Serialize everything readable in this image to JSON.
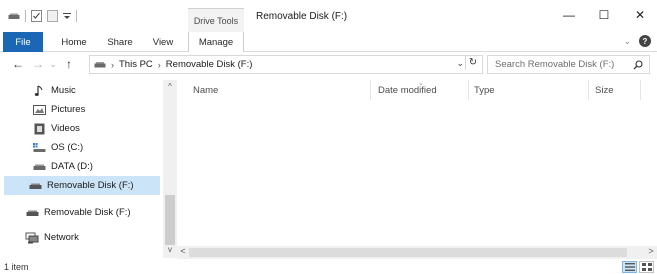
{
  "window": {
    "title": "Removable Disk (F:)",
    "context_tab": "Drive Tools",
    "minimize": "—",
    "maximize": "☐",
    "close": "✕"
  },
  "ribbon": {
    "tabs": [
      {
        "label": "File"
      },
      {
        "label": "Home"
      },
      {
        "label": "Share"
      },
      {
        "label": "View"
      },
      {
        "label": "Manage"
      }
    ],
    "collapse_glyph": "⌄",
    "help_glyph": "?"
  },
  "address": {
    "back_glyph": "←",
    "forward_glyph": "→",
    "recent_glyph": "⌄",
    "up_glyph": "↑",
    "breadcrumb": [
      "This PC",
      "Removable Disk (F:)"
    ],
    "separator": "›",
    "dropdown_glyph": "⌄",
    "refresh_glyph": "↻",
    "search_placeholder": "Search Removable Disk (F:)",
    "search_glyph": "⚲"
  },
  "navigation": {
    "items": [
      {
        "label": "Music",
        "icon": "music-icon"
      },
      {
        "label": "Pictures",
        "icon": "pictures-icon"
      },
      {
        "label": "Videos",
        "icon": "videos-icon"
      },
      {
        "label": "OS (C:)",
        "icon": "os-drive-icon"
      },
      {
        "label": "DATA (D:)",
        "icon": "drive-icon"
      },
      {
        "label": "Removable Disk (F:)",
        "icon": "removable-drive-icon",
        "selected": true
      },
      {
        "label": "Removable Disk (F:)",
        "icon": "removable-drive-icon"
      },
      {
        "label": "Network",
        "icon": "network-icon"
      }
    ],
    "scroll_up": "^",
    "scroll_down": "v"
  },
  "file_list": {
    "columns": [
      "Name",
      "Date modified",
      "Type",
      "Size"
    ],
    "rows": [],
    "scroll_left": "<",
    "scroll_right": ">"
  },
  "status": {
    "item_count": "1 item"
  },
  "colors": {
    "accent": "#1b66b5",
    "selection": "#cce4f7"
  }
}
